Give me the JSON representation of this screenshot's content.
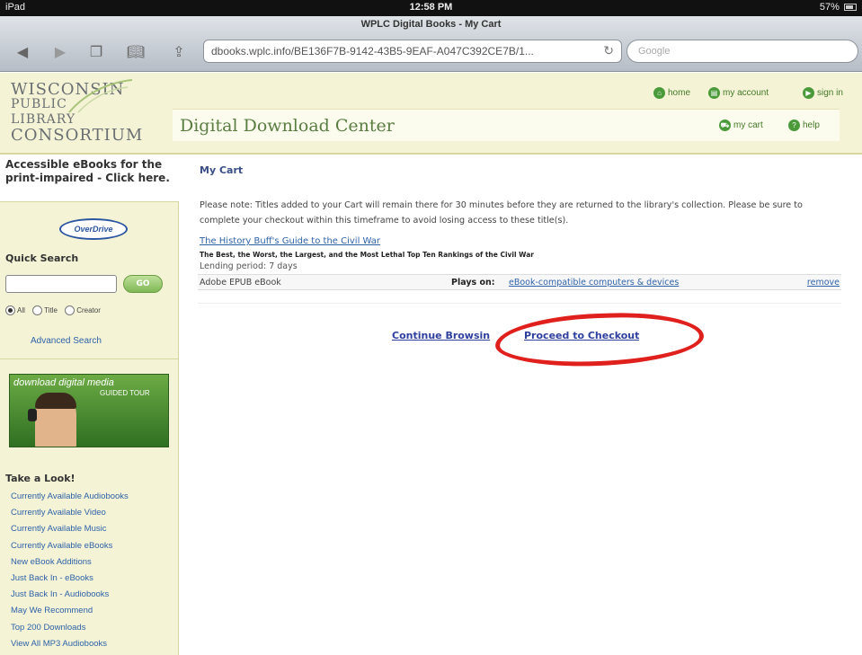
{
  "status_bar": {
    "carrier": "iPad",
    "time": "12:58 PM",
    "battery": "57%"
  },
  "browser": {
    "page_title": "WPLC Digital Books - My Cart",
    "url": "dbooks.wplc.info/BE136F7B-9142-43B5-9EAF-A047C392CE7B/1...",
    "search_placeholder": "Google"
  },
  "header": {
    "logo_lines": [
      "WISCONSIN",
      "PUBLIC",
      "LIBRARY",
      "CONSORTIUM"
    ],
    "title": "Digital Download Center",
    "links": {
      "home": "home",
      "account": "my account",
      "signin": "sign in",
      "cart": "my cart",
      "help": "help"
    }
  },
  "sidebar": {
    "promo": "Accessible eBooks for the print-impaired - Click here.",
    "overdrive": "OverDrive",
    "quick_search_label": "Quick Search",
    "go_label": "GO",
    "radios": [
      "All",
      "Title",
      "Creator"
    ],
    "selected_radio": "All",
    "advanced_search": "Advanced Search",
    "tour_title": "download digital media",
    "tour_subtitle": "GUIDED TOUR",
    "take_look_title": "Take a Look!",
    "take_look_items": [
      "Currently Available Audiobooks",
      "Currently Available Video",
      "Currently Available Music",
      "Currently Available eBooks",
      "New eBook Additions",
      "Just Back In - eBooks",
      "Just Back In - Audiobooks",
      "May We Recommend",
      "Top 200 Downloads",
      "View All MP3 Audiobooks"
    ]
  },
  "main": {
    "title": "My Cart",
    "note": "Please note: Titles added to your Cart will remain there for 30 minutes before they are returned to the library's collection. Please be sure to complete your checkout within this timeframe to avoid losing access to these title(s).",
    "item": {
      "title": "The History Buff's Guide to the Civil War",
      "subtitle": "The Best, the Worst, the Largest, and the Most Lethal Top Ten Rankings of the Civil War",
      "lending": "Lending period: 7 days",
      "format": "Adobe EPUB eBook",
      "plays_on_label": "Plays on:",
      "plays_on_link": "eBook-compatible computers & devices",
      "remove": "remove"
    },
    "continue_label": "Continue Browsin",
    "checkout_label": "Proceed to Checkout"
  },
  "colors": {
    "header_bg": "#f4f3d6",
    "link": "#2e62a8",
    "annotation_circle": "#e0201c",
    "brand_green": "#5a7d41"
  }
}
